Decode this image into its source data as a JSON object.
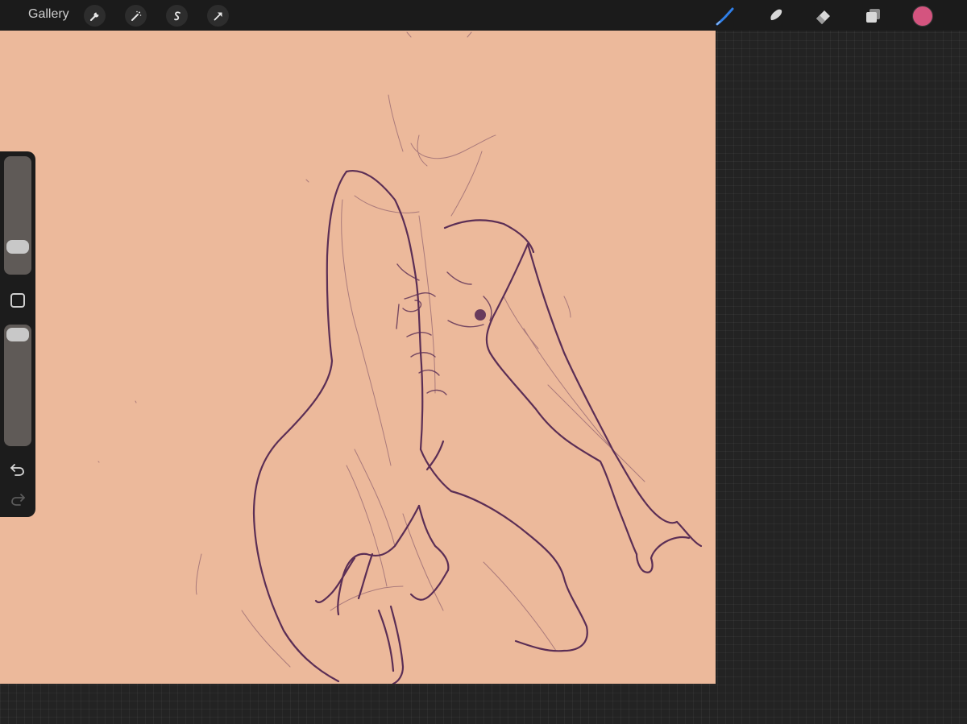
{
  "topbar": {
    "gallery_label": "Gallery",
    "actions": [
      "wrench-icon",
      "magic-wand-icon",
      "selection-s-icon",
      "transform-arrow-icon"
    ],
    "tools": [
      "brush-icon",
      "smudge-icon",
      "eraser-icon",
      "layers-icon"
    ],
    "active_tool": "brush-icon"
  },
  "colors": {
    "active_color": "#d4547f",
    "canvas_background": "#ecb99b",
    "stroke": "#5b2e55",
    "active_tool_color": "#2f7fe8"
  },
  "sidebar": {
    "brush_size_level": 0.18,
    "brush_opacity_level": 1.0,
    "controls": [
      "brush-size-slider",
      "modify-button",
      "opacity-slider",
      "undo-icon",
      "redo-icon"
    ]
  }
}
